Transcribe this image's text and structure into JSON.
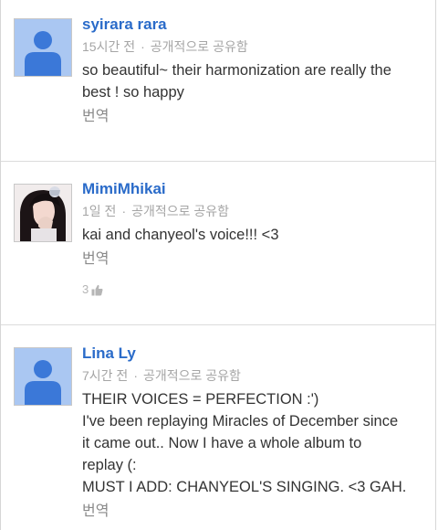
{
  "comments": [
    {
      "author": "syirara rara",
      "time": "15시간 전",
      "visibility": "공개적으로 공유함",
      "avatar": "default-person-icon",
      "lines": [
        "so beautiful~ their harmonization are really the",
        "best ! so happy"
      ],
      "translate_label": "번역"
    },
    {
      "author": "MimiMhikai",
      "time": "1일 전",
      "visibility": "공개적으로 공유함",
      "avatar": "profile-photo",
      "lines": [
        "kai and chanyeol's voice!!! <3"
      ],
      "translate_label": "번역",
      "like_count": "3"
    },
    {
      "author": "Lina Ly",
      "time": "7시간 전",
      "visibility": "공개적으로 공유함",
      "avatar": "default-person-icon",
      "lines": [
        "THEIR VOICES = PERFECTION :')",
        "I've been replaying Miracles of December since",
        "it came out.. Now I have a whole album to",
        "replay (:",
        "MUST I ADD: CHANYEOL'S SINGING. <3 GAH."
      ],
      "translate_label": "번역"
    }
  ],
  "separator": "·",
  "colors": {
    "author": "#2a6bc9",
    "meta": "#a5a5a5",
    "text": "#333333",
    "avatar_bg": "#aac7f2",
    "avatar_fg": "#3b78d8"
  }
}
